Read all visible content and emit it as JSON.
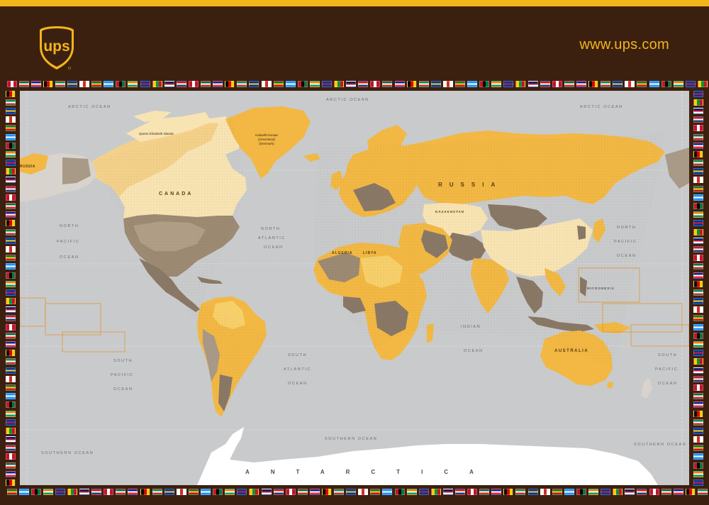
{
  "header": {
    "website": "www.ups.com",
    "logo_text": "ups"
  },
  "colors": {
    "brand_brown": "#3c200f",
    "brand_gold": "#f2b51b",
    "ocean": "#c9cacb",
    "land_gold": "#f2b843",
    "land_tan": "#9d8a73",
    "land_cream": "#f8e3b3"
  },
  "map": {
    "oceans": {
      "arctic_left": "ARCTIC OCEAN",
      "arctic_center": "ARCTIC OCEAN",
      "arctic_right": "ARCTIC OCEAN",
      "north_pacific_left_1": "NORTH",
      "north_pacific_left_2": "PACIFIC",
      "north_pacific_left_3": "OCEAN",
      "north_atlantic_1": "NORTH",
      "north_atlantic_2": "ATLANTIC",
      "north_atlantic_3": "OCEAN",
      "north_pacific_right_1": "NORTH",
      "north_pacific_right_2": "PACIFIC",
      "north_pacific_right_3": "OCEAN",
      "south_pacific_left_1": "SOUTH",
      "south_pacific_left_2": "PACIFIC",
      "south_pacific_left_3": "OCEAN",
      "south_atlantic_1": "SOUTH",
      "south_atlantic_2": "ATLANTIC",
      "south_atlantic_3": "OCEAN",
      "indian_1": "INDIAN",
      "indian_2": "OCEAN",
      "south_pacific_right_1": "SOUTH",
      "south_pacific_right_2": "PACIFIC",
      "south_pacific_right_3": "OCEAN",
      "southern_left": "SOUTHERN OCEAN",
      "southern_right": "SOUTHERN OCEAN",
      "southern_far_right": "SOUTHERN OCEAN"
    },
    "regions": {
      "canada": "CANADA",
      "russia": "RUSSIA",
      "russia_left": "RUSSIA",
      "australia": "AUSTRALIA",
      "antarctica": "ANTARCTICA",
      "greenland_1": "Kalaallit Nunaat",
      "greenland_2": "(Greenland)",
      "greenland_3": "(Denmark)",
      "kazakhstan": "KAZAKHSTAN",
      "algeria": "ALGERIA",
      "libya": "LIBYA",
      "micronesia": "MICRONESIA",
      "queen_elizabeth": "Queen Elizabeth Islands"
    }
  }
}
